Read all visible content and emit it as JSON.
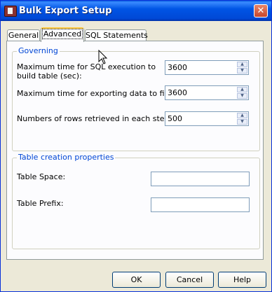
{
  "window": {
    "title": "Bulk Export Setup",
    "close_glyph": "✕",
    "app_icon": "app-icon"
  },
  "tabs": [
    {
      "label": "General",
      "active": false
    },
    {
      "label": "Advanced",
      "active": true
    },
    {
      "label": "SQL Statements",
      "active": false
    }
  ],
  "governing": {
    "title": "Governing",
    "sql_time_label": "Maximum time for SQL execution to build table (sec):",
    "sql_time_value": "3600",
    "export_time_label": "Maximum time for exporting data to file (sec):",
    "export_time_value": "3600",
    "rows_label": "Numbers of rows retrieved in each step:",
    "rows_value": "500"
  },
  "table_creation": {
    "title": "Table creation properties",
    "table_space_label": "Table Space:",
    "table_space_value": "",
    "table_prefix_label": "Table Prefix:",
    "table_prefix_value": ""
  },
  "buttons": {
    "ok": "OK",
    "cancel": "Cancel",
    "help": "Help"
  },
  "colors": {
    "title_bar": "#0055e5",
    "group_title": "#0046d5",
    "dialog_bg": "#ece9d8"
  }
}
